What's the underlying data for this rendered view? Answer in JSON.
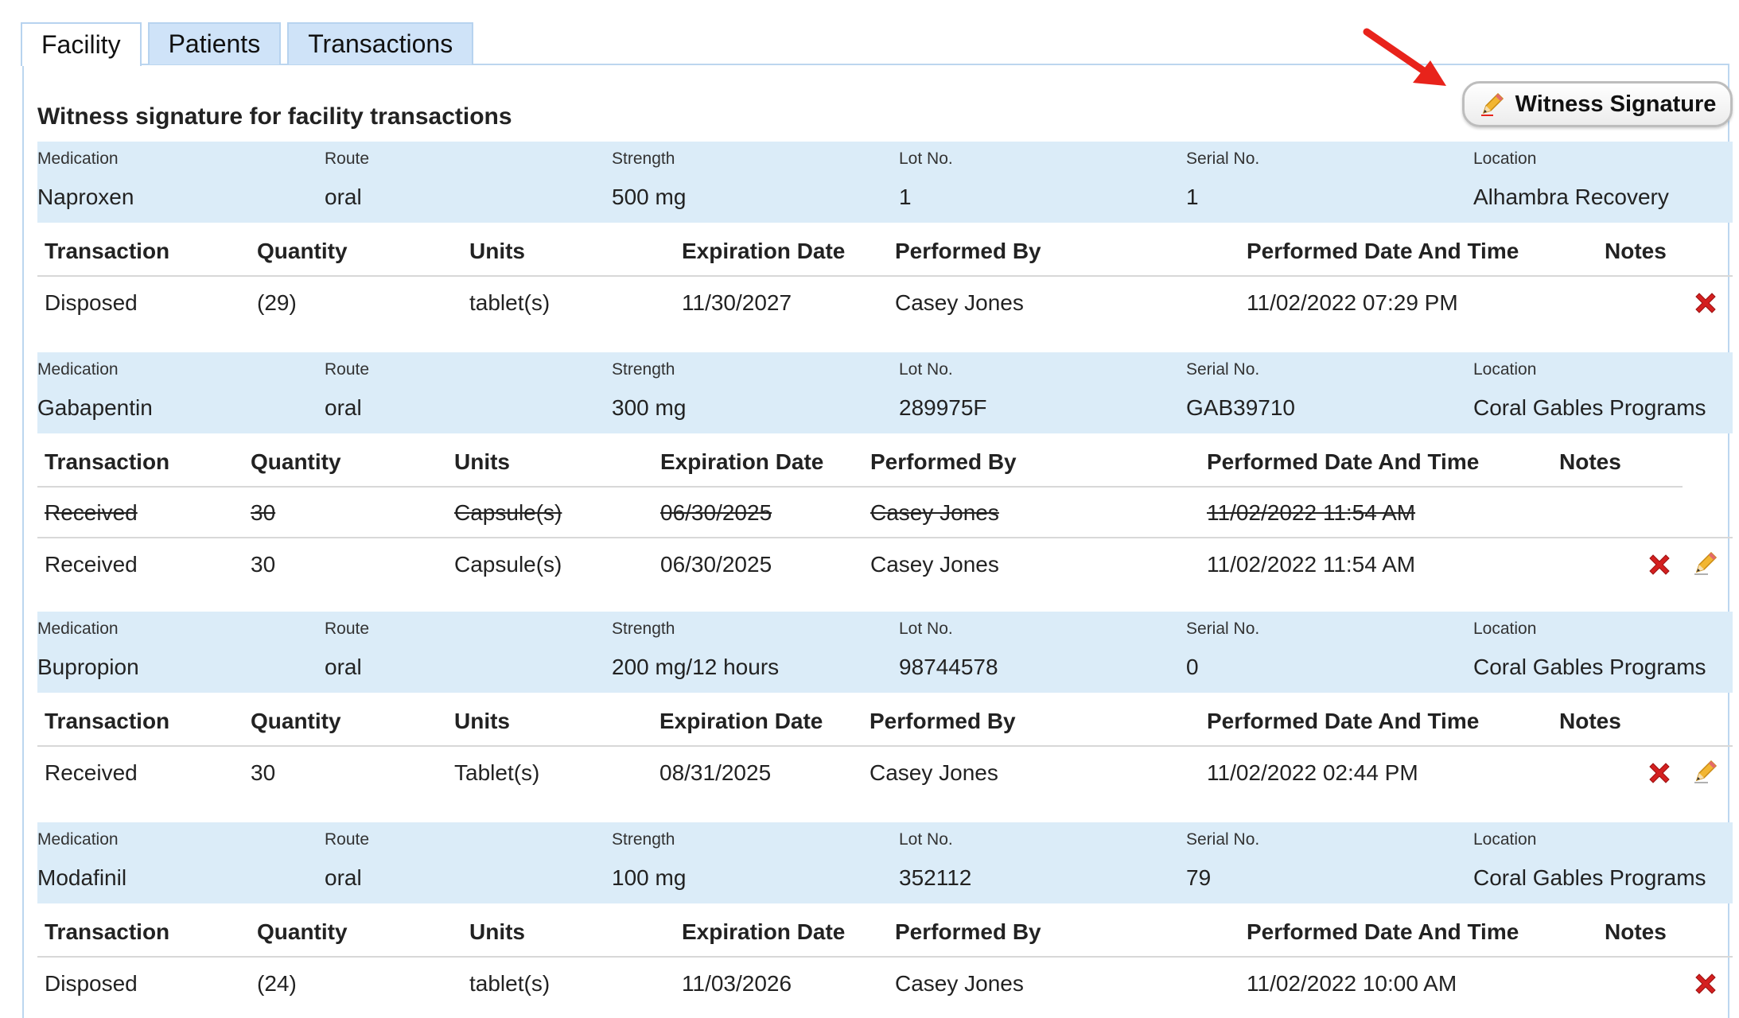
{
  "tabs": [
    {
      "label": "Facility"
    },
    {
      "label": "Patients"
    },
    {
      "label": "Transactions"
    }
  ],
  "page": {
    "title": "Witness signature for facility transactions",
    "witness_button_label": "Witness Signature"
  },
  "columns": {
    "medication": "Medication",
    "route": "Route",
    "strength": "Strength",
    "lot": "Lot No.",
    "serial": "Serial No.",
    "location": "Location"
  },
  "tx_columns": {
    "transaction": "Transaction",
    "quantity": "Quantity",
    "units": "Units",
    "expiration": "Expiration Date",
    "performed_by": "Performed By",
    "performed_dt": "Performed Date And Time",
    "notes": "Notes"
  },
  "meds": [
    {
      "medication": "Naproxen",
      "route": "oral",
      "strength": "500 mg",
      "lot": "1",
      "serial": "1",
      "location": "Alhambra Recovery",
      "rows": [
        {
          "transaction": "Disposed",
          "quantity": "(29)",
          "units": "tablet(s)",
          "expiration": "11/30/2027",
          "performed_by": "Casey Jones",
          "performed_dt": "11/02/2022 07:29 PM",
          "struck": false
        }
      ]
    },
    {
      "medication": "Gabapentin",
      "route": "oral",
      "strength": "300 mg",
      "lot": "289975F",
      "serial": "GAB39710",
      "location": "Coral Gables Programs",
      "rows": [
        {
          "transaction": "Received",
          "quantity": "30",
          "units": "Capsule(s)",
          "expiration": "06/30/2025",
          "performed_by": "Casey Jones",
          "performed_dt": "11/02/2022 11:54 AM",
          "struck": true
        },
        {
          "transaction": "Received",
          "quantity": "30",
          "units": "Capsule(s)",
          "expiration": "06/30/2025",
          "performed_by": "Casey Jones",
          "performed_dt": "11/02/2022 11:54 AM",
          "struck": false
        }
      ]
    },
    {
      "medication": "Bupropion",
      "route": "oral",
      "strength": "200 mg/12 hours",
      "lot": "98744578",
      "serial": "0",
      "location": "Coral Gables Programs",
      "rows": [
        {
          "transaction": "Received",
          "quantity": "30",
          "units": "Tablet(s)",
          "expiration": "08/31/2025",
          "performed_by": "Casey Jones",
          "performed_dt": "11/02/2022 02:44 PM",
          "struck": false
        }
      ]
    },
    {
      "medication": "Modafinil",
      "route": "oral",
      "strength": "100 mg",
      "lot": "352112",
      "serial": "79",
      "location": "Coral Gables Programs",
      "rows": [
        {
          "transaction": "Disposed",
          "quantity": "(24)",
          "units": "tablet(s)",
          "expiration": "11/03/2026",
          "performed_by": "Casey Jones",
          "performed_dt": "11/02/2022 10:00 AM",
          "struck": false
        }
      ]
    }
  ],
  "icons": {
    "delete": "red-x-icon",
    "edit": "pencil-icon",
    "annotation": "red-arrow-icon"
  },
  "colors": {
    "info_band": "#dbecf8",
    "tab_inactive": "#cfe3f8",
    "delete_red": "#d42020",
    "arrow_red": "#e8231b"
  }
}
